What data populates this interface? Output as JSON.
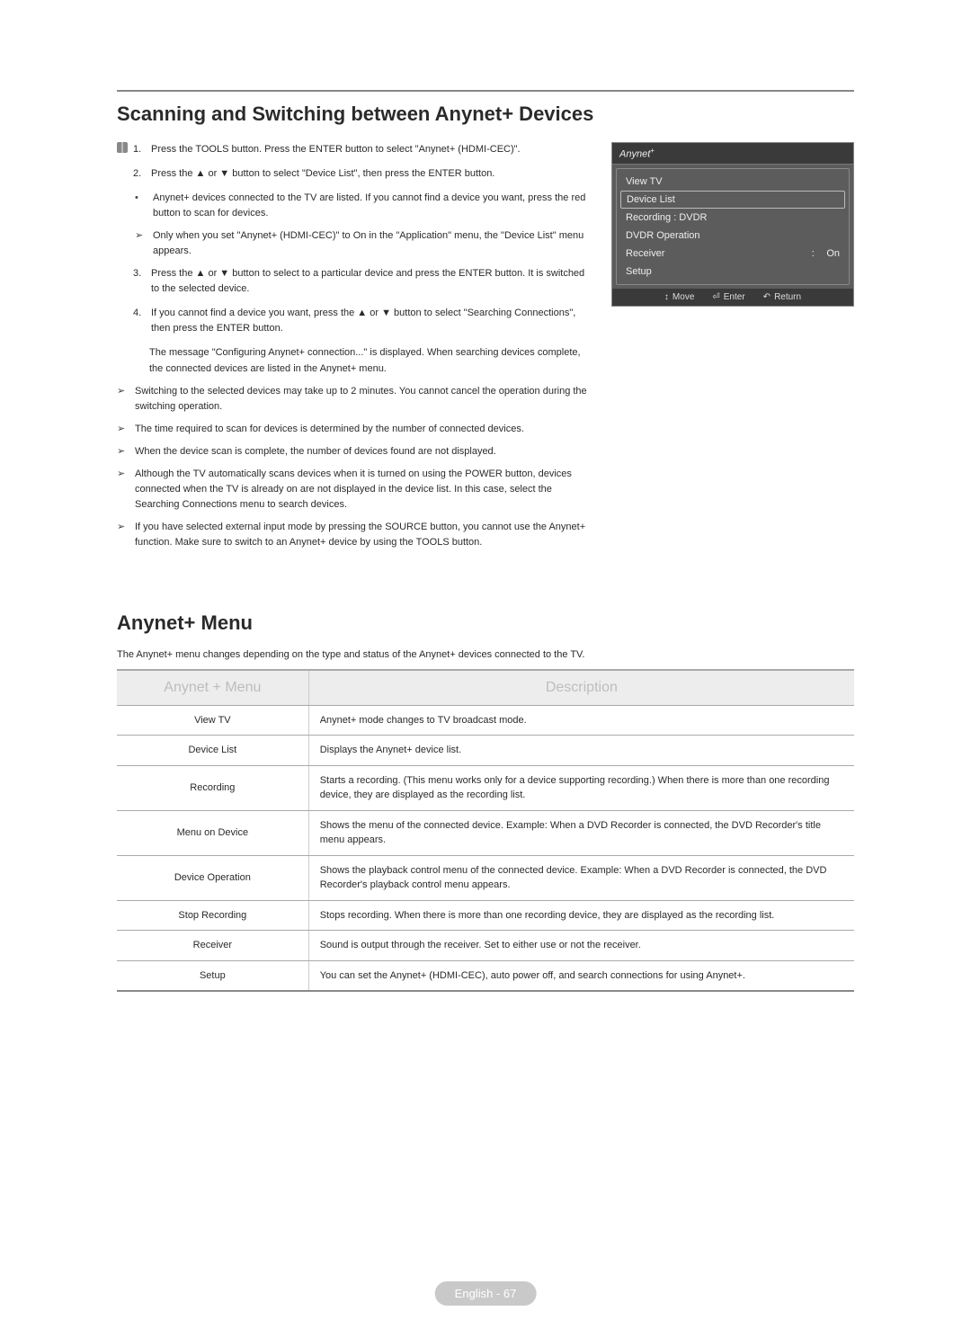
{
  "section_title": "Scanning and Switching between Anynet+ Devices",
  "steps": [
    "Press the TOOLS button. Press the ENTER button to select \"Anynet+ (HDMI-CEC)\".",
    "Press the ▲ or ▼ button to select \"Device List\", then press the ENTER button.",
    "Press the ▲ or ▼ button to select to a particular device and press the ENTER button. It is switched to the selected device.",
    "If you cannot find a device you want, press the ▲ or ▼ button to select \"Searching Connections\", then press the ENTER button."
  ],
  "step2_sub": [
    "Anynet+ devices connected to the TV are listed. If you cannot find a device you want, press the red button to scan for devices.",
    "Only when you set \"Anynet+ (HDMI-CEC)\" to On in the \"Application\" menu, the \"Device List\" menu appears."
  ],
  "step4_sub": "The message \"Configuring Anynet+ connection...\" is displayed. When searching devices complete, the connected devices are listed in the Anynet+ menu.",
  "notes": [
    "Switching to the selected devices may take up to 2 minutes. You cannot cancel the operation during the switching operation.",
    "The time required to scan for devices is determined by the number of connected devices.",
    "When the device scan is complete, the number of devices found are not displayed.",
    "Although the TV automatically scans devices when it is turned on using the POWER button, devices connected when the TV is already on are not displayed in the device list. In this case, select the Searching Connections menu to search devices.",
    "If you have selected external input mode by pressing the SOURCE button, you cannot use the Anynet+ function. Make sure to switch to an Anynet+ device by using the TOOLS button."
  ],
  "menu_section_title": "Anynet+ Menu",
  "menu_intro": "The Anynet+ menu changes depending on the type and status of the Anynet+ devices connected to the TV.",
  "table_headers": [
    "Anynet + Menu",
    "Description"
  ],
  "table_rows": [
    [
      "View TV",
      "Anynet+ mode changes to TV broadcast mode."
    ],
    [
      "Device List",
      "Displays the Anynet+ device list."
    ],
    [
      "Recording",
      "Starts a recording. (This menu works only for a device supporting recording.)\nWhen there is more than one recording device, they are displayed as the recording list."
    ],
    [
      "Menu on Device",
      "Shows the menu of the connected device.\nExample: When a DVD Recorder is connected, the DVD Recorder's title menu appears."
    ],
    [
      "Device Operation",
      "Shows the playback control menu of the connected device.\nExample: When a DVD Recorder is connected, the DVD Recorder's playback control menu appears."
    ],
    [
      "Stop Recording",
      "Stops recording. When there is more than one recording device, they are displayed as the recording list."
    ],
    [
      "Receiver",
      "Sound is output through the receiver.\nSet to either use or not the receiver."
    ],
    [
      "Setup",
      "You can set the Anynet+ (HDMI-CEC), auto power off, and search connections for using Anynet+."
    ]
  ],
  "osd": {
    "logo": "Anynet",
    "items": [
      "View TV",
      "Device List",
      "Recording : DVDR",
      "DVDR Operation",
      "Receiver",
      "Setup"
    ],
    "receiver_value": "On",
    "footer": {
      "move": "Move",
      "enter": "Enter",
      "return": "Return"
    }
  },
  "footer_text": "English - 67",
  "tools_note_prefix": ""
}
